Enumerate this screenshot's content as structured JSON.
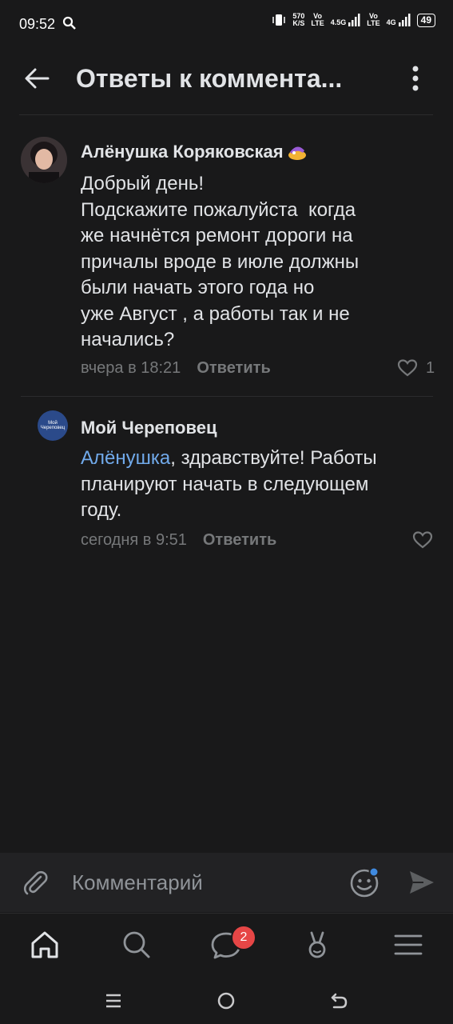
{
  "status_bar": {
    "time": "09:52",
    "net_speed_value": "570",
    "net_speed_unit": "K/S",
    "volte1": "Vo",
    "lte1": "LTE",
    "net1": "4.5G",
    "volte2": "Vo",
    "lte2": "LTE",
    "net2": "4G",
    "battery": "49"
  },
  "header": {
    "title": "Ответы к коммента..."
  },
  "comments": [
    {
      "author": "Алёнушка Коряковская",
      "text_lines": [
        "Добрый день!",
        "Подскажите пожалуйста  когда",
        "же начнётся ремонт дороги на",
        "причалы вроде в июле должны",
        "были начать этого года но",
        "уже Август , а работы так и не",
        "начались?"
      ],
      "time": "вчера в 18:21",
      "reply_label": "Ответить",
      "likes": "1"
    },
    {
      "author": "Мой Череповец",
      "avatar_text": "Мой Череповец",
      "mention": "Алёнушка",
      "text_line1_rest": ", здравствуйте! Работы",
      "text_line2": "планируют начать в следующем",
      "text_line3": "году.",
      "time": "сегодня в 9:51",
      "reply_label": "Ответить"
    }
  ],
  "input": {
    "placeholder": "Комментарий"
  },
  "tabbar": {
    "messages_badge": "2"
  },
  "colors": {
    "background": "#19191a",
    "link": "#71aaeb",
    "secondary": "#76787a",
    "badge": "#e64646",
    "accent_dot": "#3f8ae0"
  }
}
